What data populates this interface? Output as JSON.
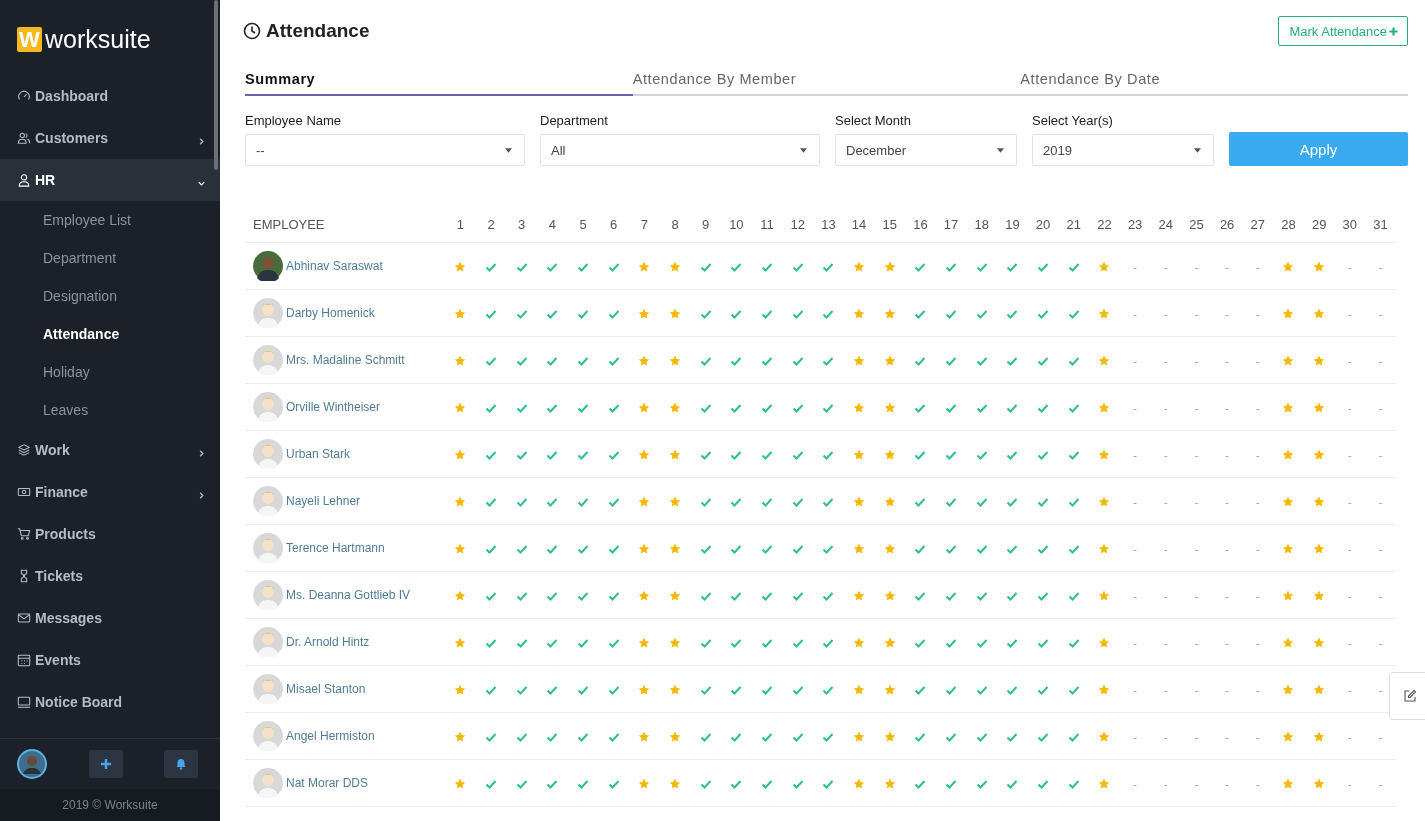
{
  "brand": {
    "mark": "W",
    "name": "worksuite"
  },
  "sidebar": {
    "items": [
      {
        "label": "Dashboard",
        "selected": false
      },
      {
        "label": "Customers",
        "selected": false,
        "expanded": false
      },
      {
        "label": "HR",
        "selected": true,
        "expanded": true,
        "children": [
          {
            "label": "Employee List",
            "selected": false
          },
          {
            "label": "Department",
            "selected": false
          },
          {
            "label": "Designation",
            "selected": false
          },
          {
            "label": "Attendance",
            "selected": true
          },
          {
            "label": "Holiday",
            "selected": false
          },
          {
            "label": "Leaves",
            "selected": false
          }
        ]
      },
      {
        "label": "Work",
        "selected": false,
        "expanded": false
      },
      {
        "label": "Finance",
        "selected": false,
        "expanded": false
      },
      {
        "label": "Products",
        "selected": false
      },
      {
        "label": "Tickets",
        "selected": false
      },
      {
        "label": "Messages",
        "selected": false
      },
      {
        "label": "Events",
        "selected": false
      },
      {
        "label": "Notice Board",
        "selected": false
      }
    ],
    "footer": "2019 © Worksuite"
  },
  "page": {
    "title": "Attendance",
    "action": "Mark Attendance"
  },
  "tabs": [
    {
      "label": "Summary",
      "selected": true
    },
    {
      "label": "Attendance By Member",
      "selected": false
    },
    {
      "label": "Attendance By Date",
      "selected": false
    }
  ],
  "filters": [
    {
      "label": "Employee Name",
      "value": "--"
    },
    {
      "label": "Department",
      "value": "All"
    },
    {
      "label": "Select Month",
      "value": "December"
    },
    {
      "label": "Select Year(s)",
      "value": "2019"
    }
  ],
  "apply_button": "Apply",
  "table": {
    "employee_header": "EMPLOYEE",
    "days": [
      "1",
      "2",
      "3",
      "4",
      "5",
      "6",
      "7",
      "8",
      "9",
      "10",
      "11",
      "12",
      "13",
      "14",
      "15",
      "16",
      "17",
      "18",
      "19",
      "20",
      "21",
      "22",
      "23",
      "24",
      "25",
      "26",
      "27",
      "28",
      "29",
      "30",
      "31"
    ],
    "rows": [
      {
        "name": "Abhinav Saraswat",
        "avatar": {
          "kind": "photo"
        },
        "marks": [
          {
            "kind": "star"
          },
          {
            "kind": "check"
          },
          {
            "kind": "check"
          },
          {
            "kind": "check"
          },
          {
            "kind": "check"
          },
          {
            "kind": "check"
          },
          {
            "kind": "star"
          },
          {
            "kind": "star"
          },
          {
            "kind": "check"
          },
          {
            "kind": "check"
          },
          {
            "kind": "check"
          },
          {
            "kind": "check"
          },
          {
            "kind": "check"
          },
          {
            "kind": "star"
          },
          {
            "kind": "star"
          },
          {
            "kind": "check"
          },
          {
            "kind": "check"
          },
          {
            "kind": "check"
          },
          {
            "kind": "check"
          },
          {
            "kind": "check"
          },
          {
            "kind": "check"
          },
          {
            "kind": "star"
          },
          {
            "kind": "empty",
            "text": "-"
          },
          {
            "kind": "empty",
            "text": "-"
          },
          {
            "kind": "empty",
            "text": "-"
          },
          {
            "kind": "empty",
            "text": "-"
          },
          {
            "kind": "empty",
            "text": "-"
          },
          {
            "kind": "star"
          },
          {
            "kind": "star"
          },
          {
            "kind": "empty",
            "text": "-"
          },
          {
            "kind": "empty",
            "text": "-"
          }
        ]
      },
      {
        "name": "Darby Homenick",
        "avatar": {
          "kind": "default"
        },
        "marks": [
          {
            "kind": "star"
          },
          {
            "kind": "check"
          },
          {
            "kind": "check"
          },
          {
            "kind": "check"
          },
          {
            "kind": "check"
          },
          {
            "kind": "check"
          },
          {
            "kind": "star"
          },
          {
            "kind": "star"
          },
          {
            "kind": "check"
          },
          {
            "kind": "check"
          },
          {
            "kind": "check"
          },
          {
            "kind": "check"
          },
          {
            "kind": "check"
          },
          {
            "kind": "star"
          },
          {
            "kind": "star"
          },
          {
            "kind": "check"
          },
          {
            "kind": "check"
          },
          {
            "kind": "check"
          },
          {
            "kind": "check"
          },
          {
            "kind": "check"
          },
          {
            "kind": "check"
          },
          {
            "kind": "star"
          },
          {
            "kind": "empty",
            "text": "-"
          },
          {
            "kind": "empty",
            "text": "-"
          },
          {
            "kind": "empty",
            "text": "-"
          },
          {
            "kind": "empty",
            "text": "-"
          },
          {
            "kind": "empty",
            "text": "-"
          },
          {
            "kind": "star"
          },
          {
            "kind": "star"
          },
          {
            "kind": "empty",
            "text": "-"
          },
          {
            "kind": "empty",
            "text": "-"
          }
        ]
      },
      {
        "name": "Mrs. Madaline Schmitt",
        "avatar": {
          "kind": "default"
        },
        "marks": [
          {
            "kind": "star"
          },
          {
            "kind": "check"
          },
          {
            "kind": "check"
          },
          {
            "kind": "check"
          },
          {
            "kind": "check"
          },
          {
            "kind": "check"
          },
          {
            "kind": "star"
          },
          {
            "kind": "star"
          },
          {
            "kind": "check"
          },
          {
            "kind": "check"
          },
          {
            "kind": "check"
          },
          {
            "kind": "check"
          },
          {
            "kind": "check"
          },
          {
            "kind": "star"
          },
          {
            "kind": "star"
          },
          {
            "kind": "check"
          },
          {
            "kind": "check"
          },
          {
            "kind": "check"
          },
          {
            "kind": "check"
          },
          {
            "kind": "check"
          },
          {
            "kind": "check"
          },
          {
            "kind": "star"
          },
          {
            "kind": "empty",
            "text": "-"
          },
          {
            "kind": "empty",
            "text": "-"
          },
          {
            "kind": "empty",
            "text": "-"
          },
          {
            "kind": "empty",
            "text": "-"
          },
          {
            "kind": "empty",
            "text": "-"
          },
          {
            "kind": "star"
          },
          {
            "kind": "star"
          },
          {
            "kind": "empty",
            "text": "-"
          },
          {
            "kind": "empty",
            "text": "-"
          }
        ]
      },
      {
        "name": "Orville Wintheiser",
        "avatar": {
          "kind": "default"
        },
        "marks": [
          {
            "kind": "star"
          },
          {
            "kind": "check"
          },
          {
            "kind": "check"
          },
          {
            "kind": "check"
          },
          {
            "kind": "check"
          },
          {
            "kind": "check"
          },
          {
            "kind": "star"
          },
          {
            "kind": "star"
          },
          {
            "kind": "check"
          },
          {
            "kind": "check"
          },
          {
            "kind": "check"
          },
          {
            "kind": "check"
          },
          {
            "kind": "check"
          },
          {
            "kind": "star"
          },
          {
            "kind": "star"
          },
          {
            "kind": "check"
          },
          {
            "kind": "check"
          },
          {
            "kind": "check"
          },
          {
            "kind": "check"
          },
          {
            "kind": "check"
          },
          {
            "kind": "check"
          },
          {
            "kind": "star"
          },
          {
            "kind": "empty",
            "text": "-"
          },
          {
            "kind": "empty",
            "text": "-"
          },
          {
            "kind": "empty",
            "text": "-"
          },
          {
            "kind": "empty",
            "text": "-"
          },
          {
            "kind": "empty",
            "text": "-"
          },
          {
            "kind": "star"
          },
          {
            "kind": "star"
          },
          {
            "kind": "empty",
            "text": "-"
          },
          {
            "kind": "empty",
            "text": "-"
          }
        ]
      },
      {
        "name": "Urban Stark",
        "avatar": {
          "kind": "default"
        },
        "marks": [
          {
            "kind": "star"
          },
          {
            "kind": "check"
          },
          {
            "kind": "check"
          },
          {
            "kind": "check"
          },
          {
            "kind": "check"
          },
          {
            "kind": "check"
          },
          {
            "kind": "star"
          },
          {
            "kind": "star"
          },
          {
            "kind": "check"
          },
          {
            "kind": "check"
          },
          {
            "kind": "check"
          },
          {
            "kind": "check"
          },
          {
            "kind": "check"
          },
          {
            "kind": "star"
          },
          {
            "kind": "star"
          },
          {
            "kind": "check"
          },
          {
            "kind": "check"
          },
          {
            "kind": "check"
          },
          {
            "kind": "check"
          },
          {
            "kind": "check"
          },
          {
            "kind": "check"
          },
          {
            "kind": "star"
          },
          {
            "kind": "empty",
            "text": "-"
          },
          {
            "kind": "empty",
            "text": "-"
          },
          {
            "kind": "empty",
            "text": "-"
          },
          {
            "kind": "empty",
            "text": "-"
          },
          {
            "kind": "empty",
            "text": "-"
          },
          {
            "kind": "star"
          },
          {
            "kind": "star"
          },
          {
            "kind": "empty",
            "text": "-"
          },
          {
            "kind": "empty",
            "text": "-"
          }
        ]
      },
      {
        "name": "Nayeli Lehner",
        "avatar": {
          "kind": "default"
        },
        "marks": [
          {
            "kind": "star"
          },
          {
            "kind": "check"
          },
          {
            "kind": "check"
          },
          {
            "kind": "check"
          },
          {
            "kind": "check"
          },
          {
            "kind": "check"
          },
          {
            "kind": "star"
          },
          {
            "kind": "star"
          },
          {
            "kind": "check"
          },
          {
            "kind": "check"
          },
          {
            "kind": "check"
          },
          {
            "kind": "check"
          },
          {
            "kind": "check"
          },
          {
            "kind": "star"
          },
          {
            "kind": "star"
          },
          {
            "kind": "check"
          },
          {
            "kind": "check"
          },
          {
            "kind": "check"
          },
          {
            "kind": "check"
          },
          {
            "kind": "check"
          },
          {
            "kind": "check"
          },
          {
            "kind": "star"
          },
          {
            "kind": "empty",
            "text": "-"
          },
          {
            "kind": "empty",
            "text": "-"
          },
          {
            "kind": "empty",
            "text": "-"
          },
          {
            "kind": "empty",
            "text": "-"
          },
          {
            "kind": "empty",
            "text": "-"
          },
          {
            "kind": "star"
          },
          {
            "kind": "star"
          },
          {
            "kind": "empty",
            "text": "-"
          },
          {
            "kind": "empty",
            "text": "-"
          }
        ]
      },
      {
        "name": "Terence Hartmann",
        "avatar": {
          "kind": "default"
        },
        "marks": [
          {
            "kind": "star"
          },
          {
            "kind": "check"
          },
          {
            "kind": "check"
          },
          {
            "kind": "check"
          },
          {
            "kind": "check"
          },
          {
            "kind": "check"
          },
          {
            "kind": "star"
          },
          {
            "kind": "star"
          },
          {
            "kind": "check"
          },
          {
            "kind": "check"
          },
          {
            "kind": "check"
          },
          {
            "kind": "check"
          },
          {
            "kind": "check"
          },
          {
            "kind": "star"
          },
          {
            "kind": "star"
          },
          {
            "kind": "check"
          },
          {
            "kind": "check"
          },
          {
            "kind": "check"
          },
          {
            "kind": "check"
          },
          {
            "kind": "check"
          },
          {
            "kind": "check"
          },
          {
            "kind": "star"
          },
          {
            "kind": "empty",
            "text": "-"
          },
          {
            "kind": "empty",
            "text": "-"
          },
          {
            "kind": "empty",
            "text": "-"
          },
          {
            "kind": "empty",
            "text": "-"
          },
          {
            "kind": "empty",
            "text": "-"
          },
          {
            "kind": "star"
          },
          {
            "kind": "star"
          },
          {
            "kind": "empty",
            "text": "-"
          },
          {
            "kind": "empty",
            "text": "-"
          }
        ]
      },
      {
        "name": "Ms. Deanna Gottlieb IV",
        "avatar": {
          "kind": "default"
        },
        "marks": [
          {
            "kind": "star"
          },
          {
            "kind": "check"
          },
          {
            "kind": "check"
          },
          {
            "kind": "check"
          },
          {
            "kind": "check"
          },
          {
            "kind": "check"
          },
          {
            "kind": "star"
          },
          {
            "kind": "star"
          },
          {
            "kind": "check"
          },
          {
            "kind": "check"
          },
          {
            "kind": "check"
          },
          {
            "kind": "check"
          },
          {
            "kind": "check"
          },
          {
            "kind": "star"
          },
          {
            "kind": "star"
          },
          {
            "kind": "check"
          },
          {
            "kind": "check"
          },
          {
            "kind": "check"
          },
          {
            "kind": "check"
          },
          {
            "kind": "check"
          },
          {
            "kind": "check"
          },
          {
            "kind": "star"
          },
          {
            "kind": "empty",
            "text": "-"
          },
          {
            "kind": "empty",
            "text": "-"
          },
          {
            "kind": "empty",
            "text": "-"
          },
          {
            "kind": "empty",
            "text": "-"
          },
          {
            "kind": "empty",
            "text": "-"
          },
          {
            "kind": "star"
          },
          {
            "kind": "star"
          },
          {
            "kind": "empty",
            "text": "-"
          },
          {
            "kind": "empty",
            "text": "-"
          }
        ]
      },
      {
        "name": "Dr. Arnold Hintz",
        "avatar": {
          "kind": "default"
        },
        "marks": [
          {
            "kind": "star"
          },
          {
            "kind": "check"
          },
          {
            "kind": "check"
          },
          {
            "kind": "check"
          },
          {
            "kind": "check"
          },
          {
            "kind": "check"
          },
          {
            "kind": "star"
          },
          {
            "kind": "star"
          },
          {
            "kind": "check"
          },
          {
            "kind": "check"
          },
          {
            "kind": "check"
          },
          {
            "kind": "check"
          },
          {
            "kind": "check"
          },
          {
            "kind": "star"
          },
          {
            "kind": "star"
          },
          {
            "kind": "check"
          },
          {
            "kind": "check"
          },
          {
            "kind": "check"
          },
          {
            "kind": "check"
          },
          {
            "kind": "check"
          },
          {
            "kind": "check"
          },
          {
            "kind": "star"
          },
          {
            "kind": "empty",
            "text": "-"
          },
          {
            "kind": "empty",
            "text": "-"
          },
          {
            "kind": "empty",
            "text": "-"
          },
          {
            "kind": "empty",
            "text": "-"
          },
          {
            "kind": "empty",
            "text": "-"
          },
          {
            "kind": "star"
          },
          {
            "kind": "star"
          },
          {
            "kind": "empty",
            "text": "-"
          },
          {
            "kind": "empty",
            "text": "-"
          }
        ]
      },
      {
        "name": "Misael Stanton",
        "avatar": {
          "kind": "default"
        },
        "marks": [
          {
            "kind": "star"
          },
          {
            "kind": "check"
          },
          {
            "kind": "check"
          },
          {
            "kind": "check"
          },
          {
            "kind": "check"
          },
          {
            "kind": "check"
          },
          {
            "kind": "star"
          },
          {
            "kind": "star"
          },
          {
            "kind": "check"
          },
          {
            "kind": "check"
          },
          {
            "kind": "check"
          },
          {
            "kind": "check"
          },
          {
            "kind": "check"
          },
          {
            "kind": "star"
          },
          {
            "kind": "star"
          },
          {
            "kind": "check"
          },
          {
            "kind": "check"
          },
          {
            "kind": "check"
          },
          {
            "kind": "check"
          },
          {
            "kind": "check"
          },
          {
            "kind": "check"
          },
          {
            "kind": "star"
          },
          {
            "kind": "empty",
            "text": "-"
          },
          {
            "kind": "empty",
            "text": "-"
          },
          {
            "kind": "empty",
            "text": "-"
          },
          {
            "kind": "empty",
            "text": "-"
          },
          {
            "kind": "empty",
            "text": "-"
          },
          {
            "kind": "star"
          },
          {
            "kind": "star"
          },
          {
            "kind": "empty",
            "text": "-"
          },
          {
            "kind": "empty",
            "text": "-"
          }
        ]
      },
      {
        "name": "Angel Hermiston",
        "avatar": {
          "kind": "default"
        },
        "marks": [
          {
            "kind": "star"
          },
          {
            "kind": "check"
          },
          {
            "kind": "check"
          },
          {
            "kind": "check"
          },
          {
            "kind": "check"
          },
          {
            "kind": "check"
          },
          {
            "kind": "star"
          },
          {
            "kind": "star"
          },
          {
            "kind": "check"
          },
          {
            "kind": "check"
          },
          {
            "kind": "check"
          },
          {
            "kind": "check"
          },
          {
            "kind": "check"
          },
          {
            "kind": "star"
          },
          {
            "kind": "star"
          },
          {
            "kind": "check"
          },
          {
            "kind": "check"
          },
          {
            "kind": "check"
          },
          {
            "kind": "check"
          },
          {
            "kind": "check"
          },
          {
            "kind": "check"
          },
          {
            "kind": "star"
          },
          {
            "kind": "empty",
            "text": "-"
          },
          {
            "kind": "empty",
            "text": "-"
          },
          {
            "kind": "empty",
            "text": "-"
          },
          {
            "kind": "empty",
            "text": "-"
          },
          {
            "kind": "empty",
            "text": "-"
          },
          {
            "kind": "star"
          },
          {
            "kind": "star"
          },
          {
            "kind": "empty",
            "text": "-"
          },
          {
            "kind": "empty",
            "text": "-"
          }
        ]
      },
      {
        "name": "Nat Morar DDS",
        "avatar": {
          "kind": "default"
        },
        "marks": [
          {
            "kind": "star"
          },
          {
            "kind": "check"
          },
          {
            "kind": "check"
          },
          {
            "kind": "check"
          },
          {
            "kind": "check"
          },
          {
            "kind": "check"
          },
          {
            "kind": "star"
          },
          {
            "kind": "star"
          },
          {
            "kind": "check"
          },
          {
            "kind": "check"
          },
          {
            "kind": "check"
          },
          {
            "kind": "check"
          },
          {
            "kind": "check"
          },
          {
            "kind": "star"
          },
          {
            "kind": "star"
          },
          {
            "kind": "check"
          },
          {
            "kind": "check"
          },
          {
            "kind": "check"
          },
          {
            "kind": "check"
          },
          {
            "kind": "check"
          },
          {
            "kind": "check"
          },
          {
            "kind": "star"
          },
          {
            "kind": "empty",
            "text": "-"
          },
          {
            "kind": "empty",
            "text": "-"
          },
          {
            "kind": "empty",
            "text": "-"
          },
          {
            "kind": "empty",
            "text": "-"
          },
          {
            "kind": "empty",
            "text": "-"
          },
          {
            "kind": "star"
          },
          {
            "kind": "star"
          },
          {
            "kind": "empty",
            "text": "-"
          },
          {
            "kind": "empty",
            "text": "-"
          }
        ]
      }
    ]
  }
}
